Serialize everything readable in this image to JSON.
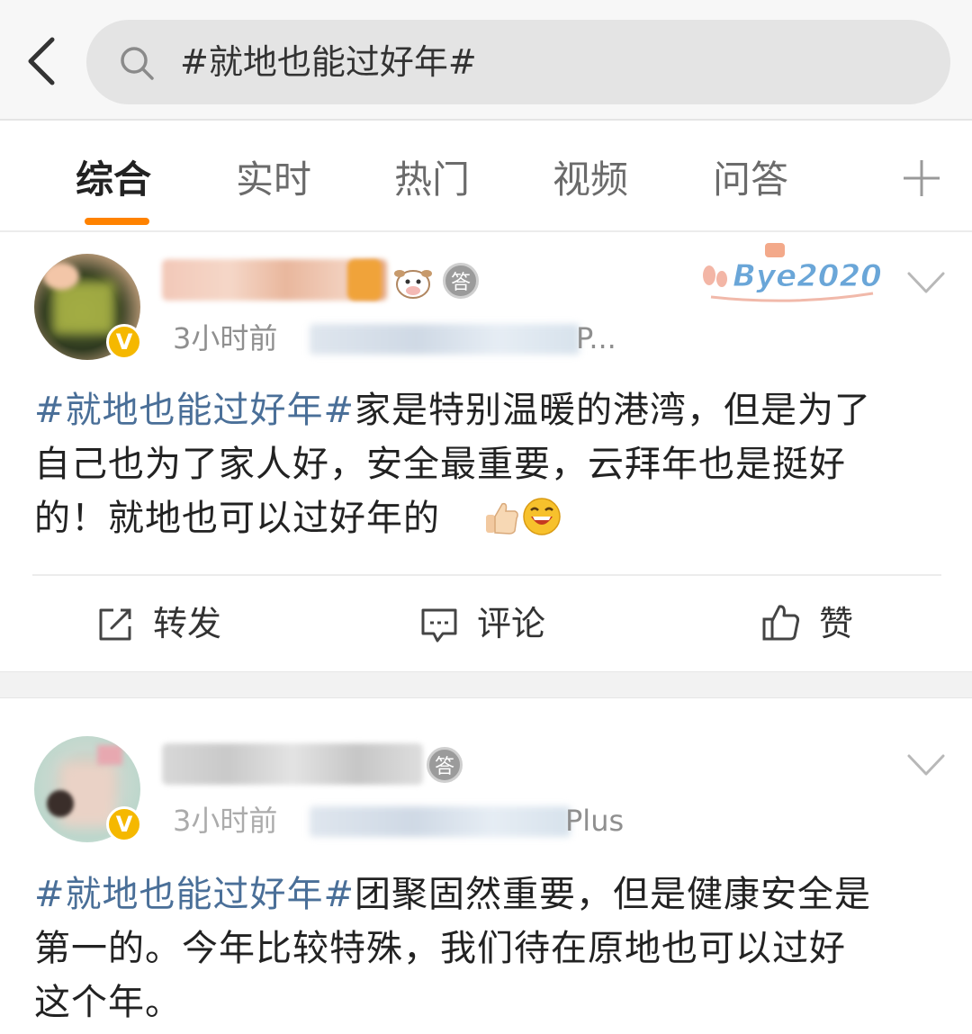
{
  "search": {
    "query": "#就地也能过好年#"
  },
  "tabs": [
    {
      "label": "综合",
      "active": true
    },
    {
      "label": "实时",
      "active": false
    },
    {
      "label": "热门",
      "active": false
    },
    {
      "label": "视频",
      "active": false
    },
    {
      "label": "问答",
      "active": false
    }
  ],
  "posts": [
    {
      "time": "3小时前",
      "source_tail": "P...",
      "topic": "#就地也能过好年#",
      "body_line1": "家是特别温暖的港湾，但是为了",
      "body_line2": "自己也为了家人好，安全最重要，云拜年也是挺好",
      "body_line3": "的！就地也可以过好年的",
      "verified_mark": "V",
      "answer_badge": "答",
      "decoration_text": "Bye2020",
      "actions": {
        "repost": "转发",
        "comment": "评论",
        "like": "赞"
      }
    },
    {
      "time": "3小时前",
      "source_tail": "Plus",
      "topic": "#就地也能过好年#",
      "body_line1": "团聚固然重要，但是健康安全是",
      "body_line2": "第一的。今年比较特殊，我们待在原地也可以过好",
      "body_line3": "这个年。",
      "verified_mark": "V",
      "answer_badge": "答"
    }
  ],
  "colors": {
    "accent": "#ff8200",
    "topic": "#4a6f98",
    "verified": "#f5b800"
  }
}
